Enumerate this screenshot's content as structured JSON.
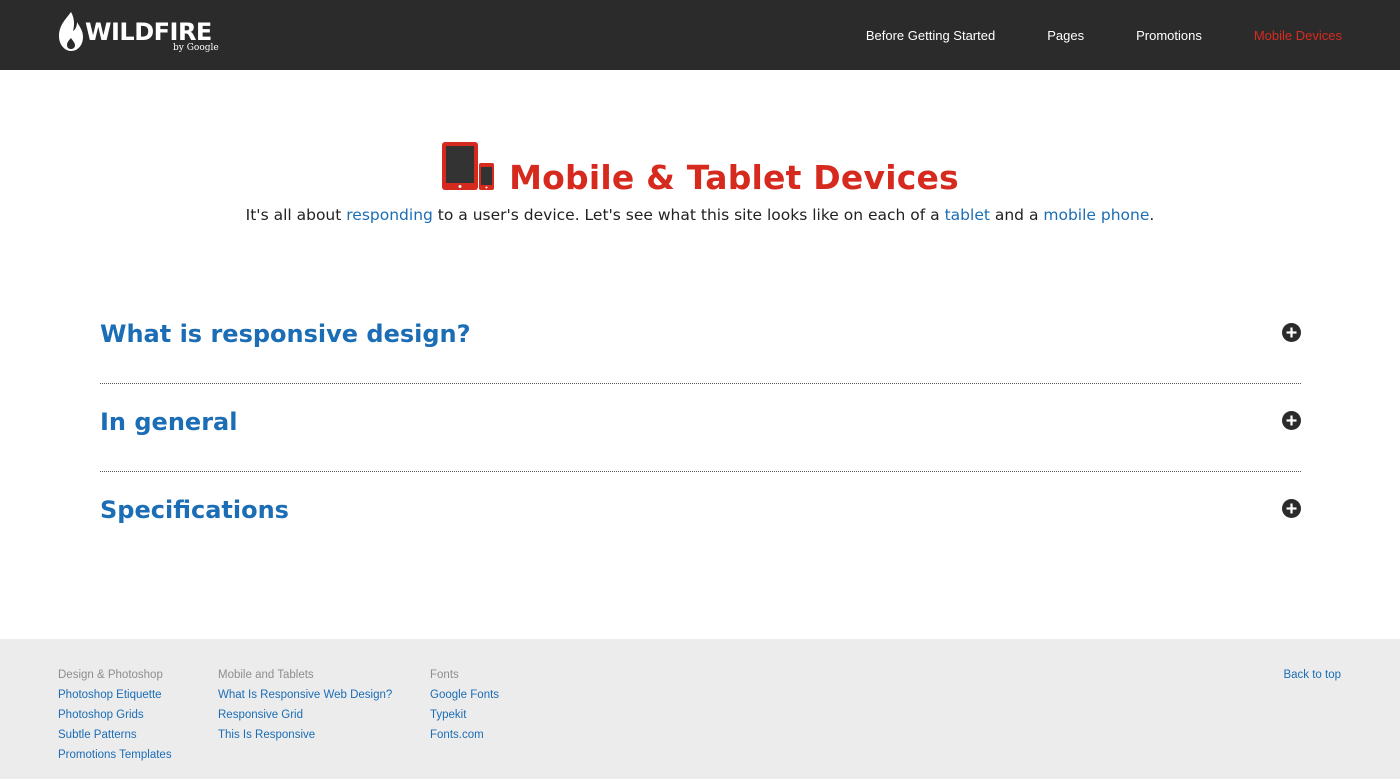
{
  "header": {
    "logo_text": "WILDFIRE",
    "logo_byline": "by Google",
    "nav": [
      {
        "label": "Before Getting Started"
      },
      {
        "label": "Pages"
      },
      {
        "label": "Promotions"
      },
      {
        "label": "Mobile Devices",
        "active": true
      }
    ]
  },
  "hero": {
    "icon": "devices-icon",
    "title": "Mobile & Tablet Devices",
    "intro": {
      "part1": "It's all about ",
      "link1": "responding",
      "part2": " to a user's device. Let's see what this site looks like on each of a ",
      "link2": "tablet",
      "part3": " and a ",
      "link3": "mobile phone",
      "part4": "."
    }
  },
  "accordion": [
    {
      "title": "What is responsive design?",
      "icon": "plus-circle-icon"
    },
    {
      "title": "In general",
      "icon": "plus-circle-icon"
    },
    {
      "title": "Specifications",
      "icon": "plus-circle-icon"
    }
  ],
  "footer": {
    "columns": [
      {
        "heading": "Design & Photoshop",
        "links": [
          "Photoshop Etiquette",
          "Photoshop Grids",
          "Subtle Patterns",
          "Promotions Templates"
        ]
      },
      {
        "heading": "Mobile and Tablets",
        "links": [
          "What Is Responsive Web Design?",
          "Responsive Grid",
          "This Is Responsive"
        ]
      },
      {
        "heading": "Fonts",
        "links": [
          "Google Fonts",
          "Typekit",
          "Fonts.com"
        ]
      }
    ],
    "back_to_top": "Back to top"
  },
  "colors": {
    "header_bg": "#2b2b2b",
    "accent_red": "#d62a1e",
    "link_blue": "#1b6db5",
    "footer_bg": "#ececec"
  }
}
